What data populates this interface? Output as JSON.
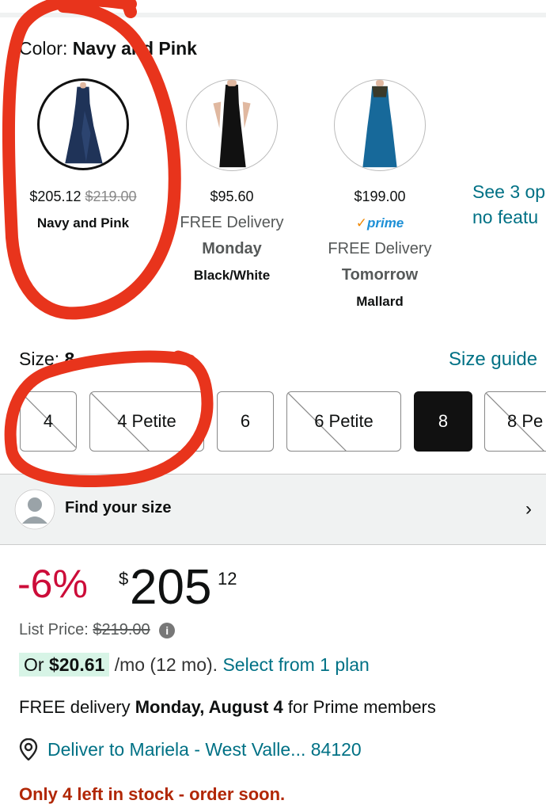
{
  "color": {
    "label": "Color:",
    "value": "Navy and Pink",
    "options": [
      {
        "price": "$205.12",
        "list_price": "$219.00",
        "name": "Navy and Pink",
        "selected": true,
        "dress_color": "#1f3358"
      },
      {
        "price": "$95.60",
        "delivery_line": "FREE Delivery",
        "delivery_day": "Monday",
        "name": "Black/White",
        "selected": false,
        "dress_color": "#111111"
      },
      {
        "price": "$199.00",
        "prime": "prime",
        "delivery_line": "FREE Delivery",
        "delivery_day": "Tomorrow",
        "name": "Mallard",
        "selected": false,
        "dress_color": "#17699a"
      }
    ],
    "see_more_line1": "See 3 op",
    "see_more_line2": "no featu"
  },
  "size": {
    "label": "Size:",
    "value": "8",
    "guide_label": "Size guide",
    "options": [
      {
        "label": "4",
        "available": false
      },
      {
        "label": "4 Petite",
        "available": false
      },
      {
        "label": "6",
        "available": true
      },
      {
        "label": "6 Petite",
        "available": false
      },
      {
        "label": "8",
        "available": true,
        "selected": true
      },
      {
        "label": "8 Pe",
        "available": false
      }
    ]
  },
  "find_size": {
    "label": "Find your size",
    "chevron": "chevron-right-icon"
  },
  "pricing": {
    "discount": "-6%",
    "currency": "$",
    "whole": "205",
    "fraction": "12",
    "list_label": "List Price:",
    "list_value": "$219.00"
  },
  "financing": {
    "or_label": "Or",
    "monthly_amount": "$20.61",
    "term": "/mo (12 mo).",
    "plan_link": "Select from 1 plan"
  },
  "delivery": {
    "prefix": "FREE delivery",
    "date": "Monday, August 4",
    "suffix": "for Prime members"
  },
  "deliver_to": {
    "text": "Deliver to Mariela - West Valle... 84120"
  },
  "stock": {
    "text": "Only 4 left in stock - order soon."
  },
  "colors": {
    "link": "#007185",
    "deal_red": "#cc0c39",
    "stock_red": "#b12704",
    "annotation": "#e8341c"
  }
}
